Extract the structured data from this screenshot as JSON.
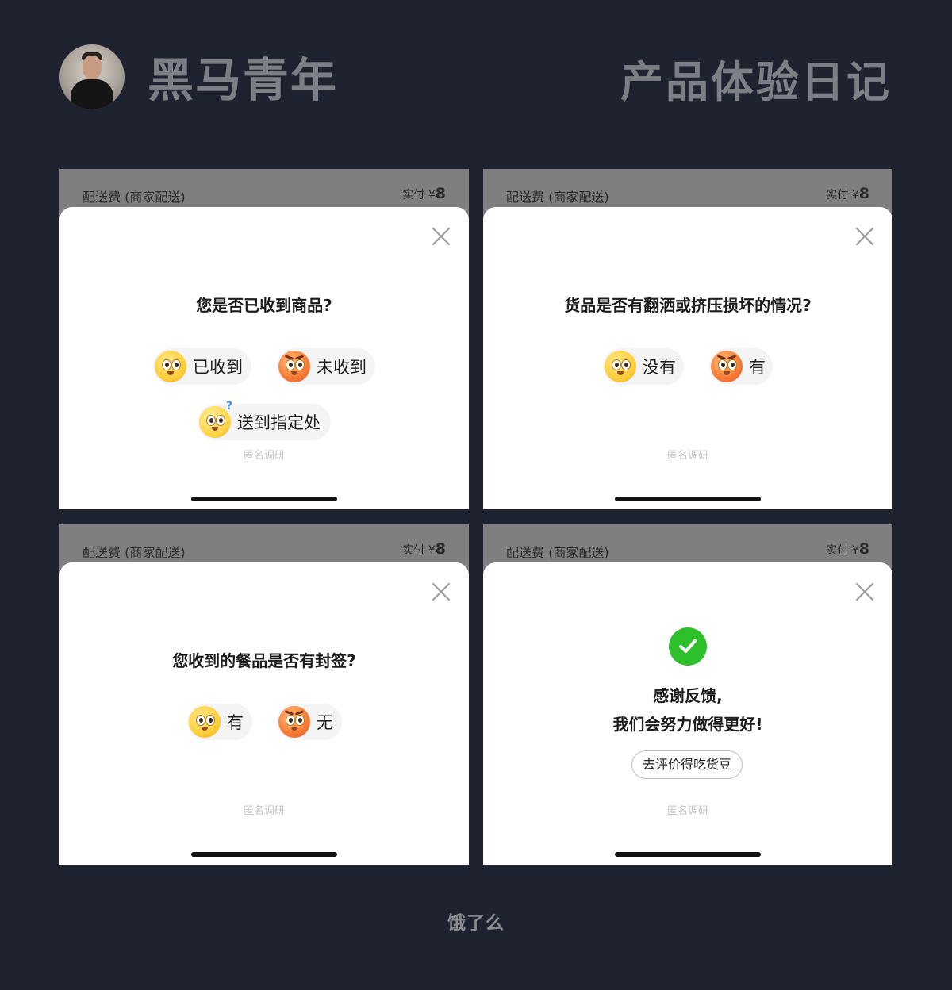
{
  "header": {
    "brand": "黑马青年",
    "series": "产品体验日记"
  },
  "cards": [
    {
      "fee_label": "配送费 (商家配送)",
      "paid_prefix": "实付 ¥",
      "paid_amount": "8",
      "question": "您是否已收到商品?",
      "options": [
        {
          "label": "已收到",
          "icon": "happy-emoji-icon"
        },
        {
          "label": "未收到",
          "icon": "angry-emoji-icon"
        },
        {
          "label": "送到指定处",
          "icon": "confused-emoji-icon"
        }
      ],
      "anon": "匿名调研"
    },
    {
      "fee_label": "配送费 (商家配送)",
      "paid_prefix": "实付 ¥",
      "paid_amount": "8",
      "question": "货品是否有翻洒或挤压损坏的情况?",
      "options": [
        {
          "label": "没有",
          "icon": "happy-emoji-icon"
        },
        {
          "label": "有",
          "icon": "angry-emoji-icon"
        }
      ],
      "anon": "匿名调研"
    },
    {
      "fee_label": "配送费 (商家配送)",
      "paid_prefix": "实付 ¥",
      "paid_amount": "8",
      "question": "您收到的餐品是否有封签?",
      "options": [
        {
          "label": "有",
          "icon": "happy-emoji-icon"
        },
        {
          "label": "无",
          "icon": "angry-emoji-icon"
        }
      ],
      "anon": "匿名调研"
    },
    {
      "fee_label": "配送费 (商家配送)",
      "paid_prefix": "实付 ¥",
      "paid_amount": "8",
      "thanks_line1": "感谢反馈,",
      "thanks_line2": "我们会努力做得更好!",
      "cta": "去评价得吃货豆",
      "anon": "匿名调研"
    }
  ],
  "footer": "饿了么",
  "colors": {
    "background": "#1f2330",
    "success": "#2ec02b"
  }
}
